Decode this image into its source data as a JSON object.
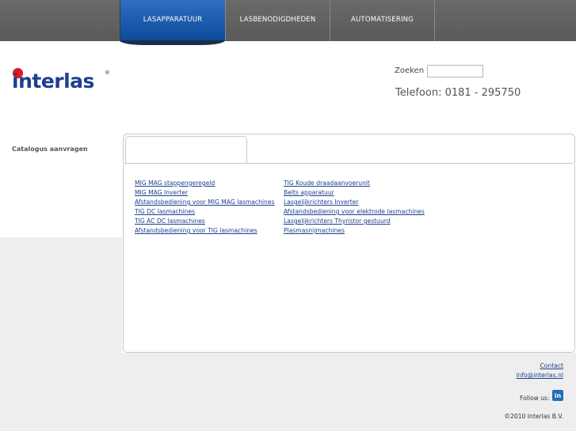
{
  "nav": {
    "tabs": [
      {
        "label": "LASAPPARATUUR",
        "active": true
      },
      {
        "label": "LASBENODIGDHEDEN",
        "active": false
      },
      {
        "label": "AUTOMATISERING",
        "active": false
      }
    ]
  },
  "logo": {
    "text": "interlas",
    "reg_mark": "®"
  },
  "search": {
    "label": "Zoeken",
    "value": ""
  },
  "phone": "Telefoon: 0181 - 295750",
  "sidebar": {
    "catalog_link": "Catalogus aanvragen"
  },
  "links": {
    "col1": [
      "MIG MAG stappengeregeld",
      "MIG MAG Inverter",
      "Afstandsbediening voor MIG MAG lasmachines",
      "TIG DC lasmachines",
      "TIG AC DC lasmachines",
      "Afstandsbediening voor TIG lasmachines"
    ],
    "col2": [
      "TIG Koude draadaanvoerunit",
      "Belts apparatuur",
      "Lasgelijkrichters Inverter",
      "Afstandsbediening voor elektrode lasmachines",
      "Lasgelijkrichters Thyristor gestuurd",
      "Plasmasnijmachines"
    ]
  },
  "footer": {
    "contact": "Contact",
    "email": "info@interlas.nl",
    "follow": "Follow us:",
    "linkedin_icon": "linkedin-icon",
    "linkedin_glyph": "in",
    "copyright": "©2010 Interlas B.V."
  },
  "colors": {
    "brand_blue": "#1d3f8e",
    "brand_red": "#e3161e",
    "nav_active": "#0c4a9a"
  }
}
